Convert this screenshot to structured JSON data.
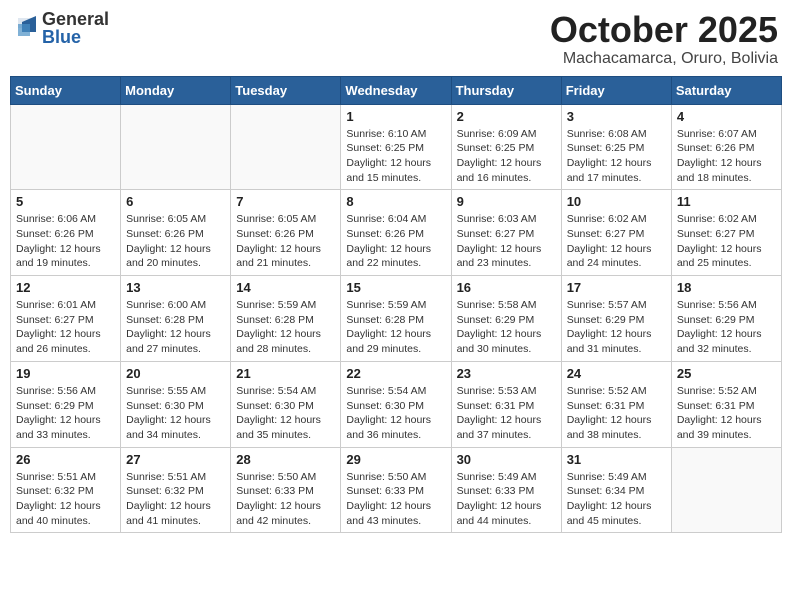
{
  "header": {
    "logo": {
      "general": "General",
      "blue": "Blue"
    },
    "title": "October 2025",
    "location": "Machacamarca, Oruro, Bolivia"
  },
  "days_of_week": [
    "Sunday",
    "Monday",
    "Tuesday",
    "Wednesday",
    "Thursday",
    "Friday",
    "Saturday"
  ],
  "weeks": [
    [
      {
        "day": "",
        "info": ""
      },
      {
        "day": "",
        "info": ""
      },
      {
        "day": "",
        "info": ""
      },
      {
        "day": "1",
        "info": "Sunrise: 6:10 AM\nSunset: 6:25 PM\nDaylight: 12 hours\nand 15 minutes."
      },
      {
        "day": "2",
        "info": "Sunrise: 6:09 AM\nSunset: 6:25 PM\nDaylight: 12 hours\nand 16 minutes."
      },
      {
        "day": "3",
        "info": "Sunrise: 6:08 AM\nSunset: 6:25 PM\nDaylight: 12 hours\nand 17 minutes."
      },
      {
        "day": "4",
        "info": "Sunrise: 6:07 AM\nSunset: 6:26 PM\nDaylight: 12 hours\nand 18 minutes."
      }
    ],
    [
      {
        "day": "5",
        "info": "Sunrise: 6:06 AM\nSunset: 6:26 PM\nDaylight: 12 hours\nand 19 minutes."
      },
      {
        "day": "6",
        "info": "Sunrise: 6:05 AM\nSunset: 6:26 PM\nDaylight: 12 hours\nand 20 minutes."
      },
      {
        "day": "7",
        "info": "Sunrise: 6:05 AM\nSunset: 6:26 PM\nDaylight: 12 hours\nand 21 minutes."
      },
      {
        "day": "8",
        "info": "Sunrise: 6:04 AM\nSunset: 6:26 PM\nDaylight: 12 hours\nand 22 minutes."
      },
      {
        "day": "9",
        "info": "Sunrise: 6:03 AM\nSunset: 6:27 PM\nDaylight: 12 hours\nand 23 minutes."
      },
      {
        "day": "10",
        "info": "Sunrise: 6:02 AM\nSunset: 6:27 PM\nDaylight: 12 hours\nand 24 minutes."
      },
      {
        "day": "11",
        "info": "Sunrise: 6:02 AM\nSunset: 6:27 PM\nDaylight: 12 hours\nand 25 minutes."
      }
    ],
    [
      {
        "day": "12",
        "info": "Sunrise: 6:01 AM\nSunset: 6:27 PM\nDaylight: 12 hours\nand 26 minutes."
      },
      {
        "day": "13",
        "info": "Sunrise: 6:00 AM\nSunset: 6:28 PM\nDaylight: 12 hours\nand 27 minutes."
      },
      {
        "day": "14",
        "info": "Sunrise: 5:59 AM\nSunset: 6:28 PM\nDaylight: 12 hours\nand 28 minutes."
      },
      {
        "day": "15",
        "info": "Sunrise: 5:59 AM\nSunset: 6:28 PM\nDaylight: 12 hours\nand 29 minutes."
      },
      {
        "day": "16",
        "info": "Sunrise: 5:58 AM\nSunset: 6:29 PM\nDaylight: 12 hours\nand 30 minutes."
      },
      {
        "day": "17",
        "info": "Sunrise: 5:57 AM\nSunset: 6:29 PM\nDaylight: 12 hours\nand 31 minutes."
      },
      {
        "day": "18",
        "info": "Sunrise: 5:56 AM\nSunset: 6:29 PM\nDaylight: 12 hours\nand 32 minutes."
      }
    ],
    [
      {
        "day": "19",
        "info": "Sunrise: 5:56 AM\nSunset: 6:29 PM\nDaylight: 12 hours\nand 33 minutes."
      },
      {
        "day": "20",
        "info": "Sunrise: 5:55 AM\nSunset: 6:30 PM\nDaylight: 12 hours\nand 34 minutes."
      },
      {
        "day": "21",
        "info": "Sunrise: 5:54 AM\nSunset: 6:30 PM\nDaylight: 12 hours\nand 35 minutes."
      },
      {
        "day": "22",
        "info": "Sunrise: 5:54 AM\nSunset: 6:30 PM\nDaylight: 12 hours\nand 36 minutes."
      },
      {
        "day": "23",
        "info": "Sunrise: 5:53 AM\nSunset: 6:31 PM\nDaylight: 12 hours\nand 37 minutes."
      },
      {
        "day": "24",
        "info": "Sunrise: 5:52 AM\nSunset: 6:31 PM\nDaylight: 12 hours\nand 38 minutes."
      },
      {
        "day": "25",
        "info": "Sunrise: 5:52 AM\nSunset: 6:31 PM\nDaylight: 12 hours\nand 39 minutes."
      }
    ],
    [
      {
        "day": "26",
        "info": "Sunrise: 5:51 AM\nSunset: 6:32 PM\nDaylight: 12 hours\nand 40 minutes."
      },
      {
        "day": "27",
        "info": "Sunrise: 5:51 AM\nSunset: 6:32 PM\nDaylight: 12 hours\nand 41 minutes."
      },
      {
        "day": "28",
        "info": "Sunrise: 5:50 AM\nSunset: 6:33 PM\nDaylight: 12 hours\nand 42 minutes."
      },
      {
        "day": "29",
        "info": "Sunrise: 5:50 AM\nSunset: 6:33 PM\nDaylight: 12 hours\nand 43 minutes."
      },
      {
        "day": "30",
        "info": "Sunrise: 5:49 AM\nSunset: 6:33 PM\nDaylight: 12 hours\nand 44 minutes."
      },
      {
        "day": "31",
        "info": "Sunrise: 5:49 AM\nSunset: 6:34 PM\nDaylight: 12 hours\nand 45 minutes."
      },
      {
        "day": "",
        "info": ""
      }
    ]
  ]
}
